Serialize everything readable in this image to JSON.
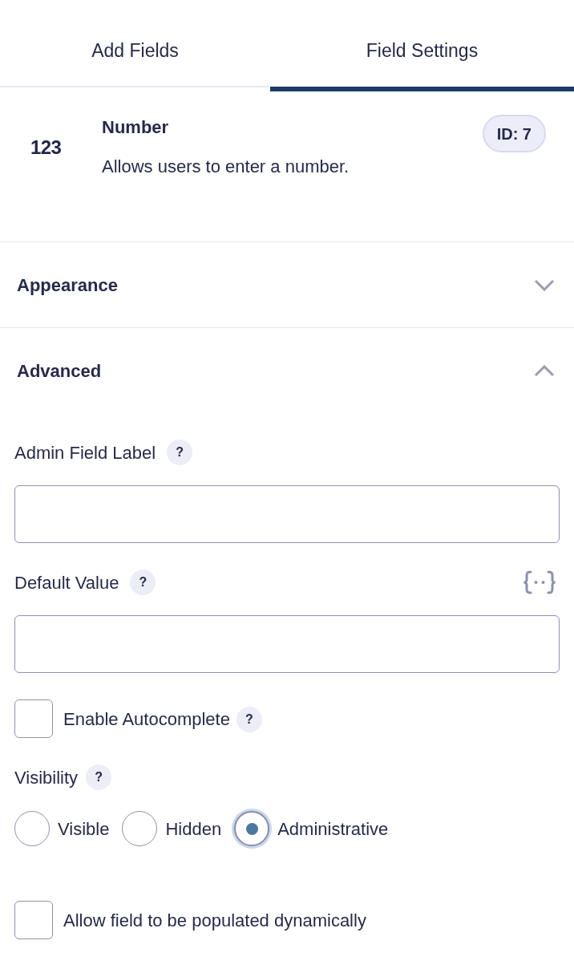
{
  "tabs": [
    {
      "label": "Add Fields",
      "selected": false
    },
    {
      "label": "Field Settings",
      "selected": true
    }
  ],
  "field": {
    "icon_text": "123",
    "name": "Number",
    "description": "Allows users to enter a number.",
    "id_badge": "ID: 7"
  },
  "sections": [
    {
      "title": "Appearance",
      "expanded": false
    },
    {
      "title": "Advanced",
      "expanded": true,
      "settings": [
        {
          "kind": "text_input",
          "label": "Admin Field Label",
          "help": "?",
          "merge_tags": false
        },
        {
          "kind": "text_input",
          "label": "Default Value",
          "help": "?",
          "merge_tags": true
        },
        {
          "kind": "checkbox",
          "label": "Enable Autocomplete",
          "help": "?",
          "checked": false
        },
        {
          "kind": "radio_group",
          "label": "Visibility",
          "help": "?",
          "options": [
            {
              "label": "Visible",
              "selected": false
            },
            {
              "label": "Hidden",
              "selected": false
            },
            {
              "label": "Administrative",
              "selected": true
            }
          ]
        },
        {
          "kind": "checkbox",
          "label": "Allow field to be populated dynamically",
          "checked": false
        }
      ]
    }
  ]
}
